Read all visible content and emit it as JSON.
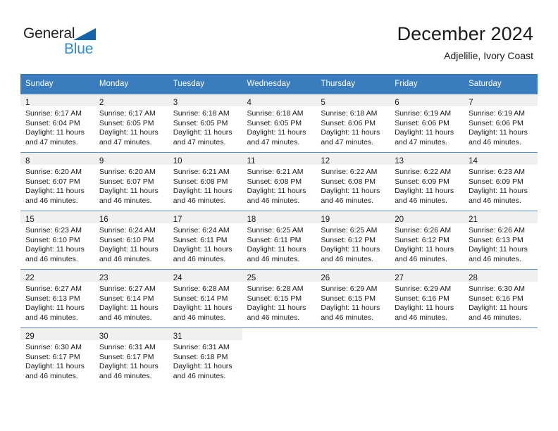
{
  "brand": {
    "name_top": "General",
    "name_bottom": "Blue",
    "triangle_color": "#1464aa",
    "blue_color": "#2e8bd4"
  },
  "header": {
    "title": "December 2024",
    "subtitle": "Adjelilie, Ivory Coast"
  },
  "theme": {
    "header_row_bg": "#3a7dbf",
    "header_row_text": "#ffffff",
    "daynum_band_bg": "#f0f0f0",
    "row_divider": "#5b91c6"
  },
  "calendar": {
    "weekday_headers": [
      "Sunday",
      "Monday",
      "Tuesday",
      "Wednesday",
      "Thursday",
      "Friday",
      "Saturday"
    ],
    "weeks": [
      [
        {
          "day": "1",
          "sunrise": "Sunrise: 6:17 AM",
          "sunset": "Sunset: 6:04 PM",
          "daylight_line1": "Daylight: 11 hours",
          "daylight_line2": "and 47 minutes."
        },
        {
          "day": "2",
          "sunrise": "Sunrise: 6:17 AM",
          "sunset": "Sunset: 6:05 PM",
          "daylight_line1": "Daylight: 11 hours",
          "daylight_line2": "and 47 minutes."
        },
        {
          "day": "3",
          "sunrise": "Sunrise: 6:18 AM",
          "sunset": "Sunset: 6:05 PM",
          "daylight_line1": "Daylight: 11 hours",
          "daylight_line2": "and 47 minutes."
        },
        {
          "day": "4",
          "sunrise": "Sunrise: 6:18 AM",
          "sunset": "Sunset: 6:05 PM",
          "daylight_line1": "Daylight: 11 hours",
          "daylight_line2": "and 47 minutes."
        },
        {
          "day": "5",
          "sunrise": "Sunrise: 6:18 AM",
          "sunset": "Sunset: 6:06 PM",
          "daylight_line1": "Daylight: 11 hours",
          "daylight_line2": "and 47 minutes."
        },
        {
          "day": "6",
          "sunrise": "Sunrise: 6:19 AM",
          "sunset": "Sunset: 6:06 PM",
          "daylight_line1": "Daylight: 11 hours",
          "daylight_line2": "and 47 minutes."
        },
        {
          "day": "7",
          "sunrise": "Sunrise: 6:19 AM",
          "sunset": "Sunset: 6:06 PM",
          "daylight_line1": "Daylight: 11 hours",
          "daylight_line2": "and 46 minutes."
        }
      ],
      [
        {
          "day": "8",
          "sunrise": "Sunrise: 6:20 AM",
          "sunset": "Sunset: 6:07 PM",
          "daylight_line1": "Daylight: 11 hours",
          "daylight_line2": "and 46 minutes."
        },
        {
          "day": "9",
          "sunrise": "Sunrise: 6:20 AM",
          "sunset": "Sunset: 6:07 PM",
          "daylight_line1": "Daylight: 11 hours",
          "daylight_line2": "and 46 minutes."
        },
        {
          "day": "10",
          "sunrise": "Sunrise: 6:21 AM",
          "sunset": "Sunset: 6:08 PM",
          "daylight_line1": "Daylight: 11 hours",
          "daylight_line2": "and 46 minutes."
        },
        {
          "day": "11",
          "sunrise": "Sunrise: 6:21 AM",
          "sunset": "Sunset: 6:08 PM",
          "daylight_line1": "Daylight: 11 hours",
          "daylight_line2": "and 46 minutes."
        },
        {
          "day": "12",
          "sunrise": "Sunrise: 6:22 AM",
          "sunset": "Sunset: 6:08 PM",
          "daylight_line1": "Daylight: 11 hours",
          "daylight_line2": "and 46 minutes."
        },
        {
          "day": "13",
          "sunrise": "Sunrise: 6:22 AM",
          "sunset": "Sunset: 6:09 PM",
          "daylight_line1": "Daylight: 11 hours",
          "daylight_line2": "and 46 minutes."
        },
        {
          "day": "14",
          "sunrise": "Sunrise: 6:23 AM",
          "sunset": "Sunset: 6:09 PM",
          "daylight_line1": "Daylight: 11 hours",
          "daylight_line2": "and 46 minutes."
        }
      ],
      [
        {
          "day": "15",
          "sunrise": "Sunrise: 6:23 AM",
          "sunset": "Sunset: 6:10 PM",
          "daylight_line1": "Daylight: 11 hours",
          "daylight_line2": "and 46 minutes."
        },
        {
          "day": "16",
          "sunrise": "Sunrise: 6:24 AM",
          "sunset": "Sunset: 6:10 PM",
          "daylight_line1": "Daylight: 11 hours",
          "daylight_line2": "and 46 minutes."
        },
        {
          "day": "17",
          "sunrise": "Sunrise: 6:24 AM",
          "sunset": "Sunset: 6:11 PM",
          "daylight_line1": "Daylight: 11 hours",
          "daylight_line2": "and 46 minutes."
        },
        {
          "day": "18",
          "sunrise": "Sunrise: 6:25 AM",
          "sunset": "Sunset: 6:11 PM",
          "daylight_line1": "Daylight: 11 hours",
          "daylight_line2": "and 46 minutes."
        },
        {
          "day": "19",
          "sunrise": "Sunrise: 6:25 AM",
          "sunset": "Sunset: 6:12 PM",
          "daylight_line1": "Daylight: 11 hours",
          "daylight_line2": "and 46 minutes."
        },
        {
          "day": "20",
          "sunrise": "Sunrise: 6:26 AM",
          "sunset": "Sunset: 6:12 PM",
          "daylight_line1": "Daylight: 11 hours",
          "daylight_line2": "and 46 minutes."
        },
        {
          "day": "21",
          "sunrise": "Sunrise: 6:26 AM",
          "sunset": "Sunset: 6:13 PM",
          "daylight_line1": "Daylight: 11 hours",
          "daylight_line2": "and 46 minutes."
        }
      ],
      [
        {
          "day": "22",
          "sunrise": "Sunrise: 6:27 AM",
          "sunset": "Sunset: 6:13 PM",
          "daylight_line1": "Daylight: 11 hours",
          "daylight_line2": "and 46 minutes."
        },
        {
          "day": "23",
          "sunrise": "Sunrise: 6:27 AM",
          "sunset": "Sunset: 6:14 PM",
          "daylight_line1": "Daylight: 11 hours",
          "daylight_line2": "and 46 minutes."
        },
        {
          "day": "24",
          "sunrise": "Sunrise: 6:28 AM",
          "sunset": "Sunset: 6:14 PM",
          "daylight_line1": "Daylight: 11 hours",
          "daylight_line2": "and 46 minutes."
        },
        {
          "day": "25",
          "sunrise": "Sunrise: 6:28 AM",
          "sunset": "Sunset: 6:15 PM",
          "daylight_line1": "Daylight: 11 hours",
          "daylight_line2": "and 46 minutes."
        },
        {
          "day": "26",
          "sunrise": "Sunrise: 6:29 AM",
          "sunset": "Sunset: 6:15 PM",
          "daylight_line1": "Daylight: 11 hours",
          "daylight_line2": "and 46 minutes."
        },
        {
          "day": "27",
          "sunrise": "Sunrise: 6:29 AM",
          "sunset": "Sunset: 6:16 PM",
          "daylight_line1": "Daylight: 11 hours",
          "daylight_line2": "and 46 minutes."
        },
        {
          "day": "28",
          "sunrise": "Sunrise: 6:30 AM",
          "sunset": "Sunset: 6:16 PM",
          "daylight_line1": "Daylight: 11 hours",
          "daylight_line2": "and 46 minutes."
        }
      ],
      [
        {
          "day": "29",
          "sunrise": "Sunrise: 6:30 AM",
          "sunset": "Sunset: 6:17 PM",
          "daylight_line1": "Daylight: 11 hours",
          "daylight_line2": "and 46 minutes."
        },
        {
          "day": "30",
          "sunrise": "Sunrise: 6:31 AM",
          "sunset": "Sunset: 6:17 PM",
          "daylight_line1": "Daylight: 11 hours",
          "daylight_line2": "and 46 minutes."
        },
        {
          "day": "31",
          "sunrise": "Sunrise: 6:31 AM",
          "sunset": "Sunset: 6:18 PM",
          "daylight_line1": "Daylight: 11 hours",
          "daylight_line2": "and 46 minutes."
        },
        {
          "day": "",
          "sunrise": "",
          "sunset": "",
          "daylight_line1": "",
          "daylight_line2": ""
        },
        {
          "day": "",
          "sunrise": "",
          "sunset": "",
          "daylight_line1": "",
          "daylight_line2": ""
        },
        {
          "day": "",
          "sunrise": "",
          "sunset": "",
          "daylight_line1": "",
          "daylight_line2": ""
        },
        {
          "day": "",
          "sunrise": "",
          "sunset": "",
          "daylight_line1": "",
          "daylight_line2": ""
        }
      ]
    ]
  }
}
